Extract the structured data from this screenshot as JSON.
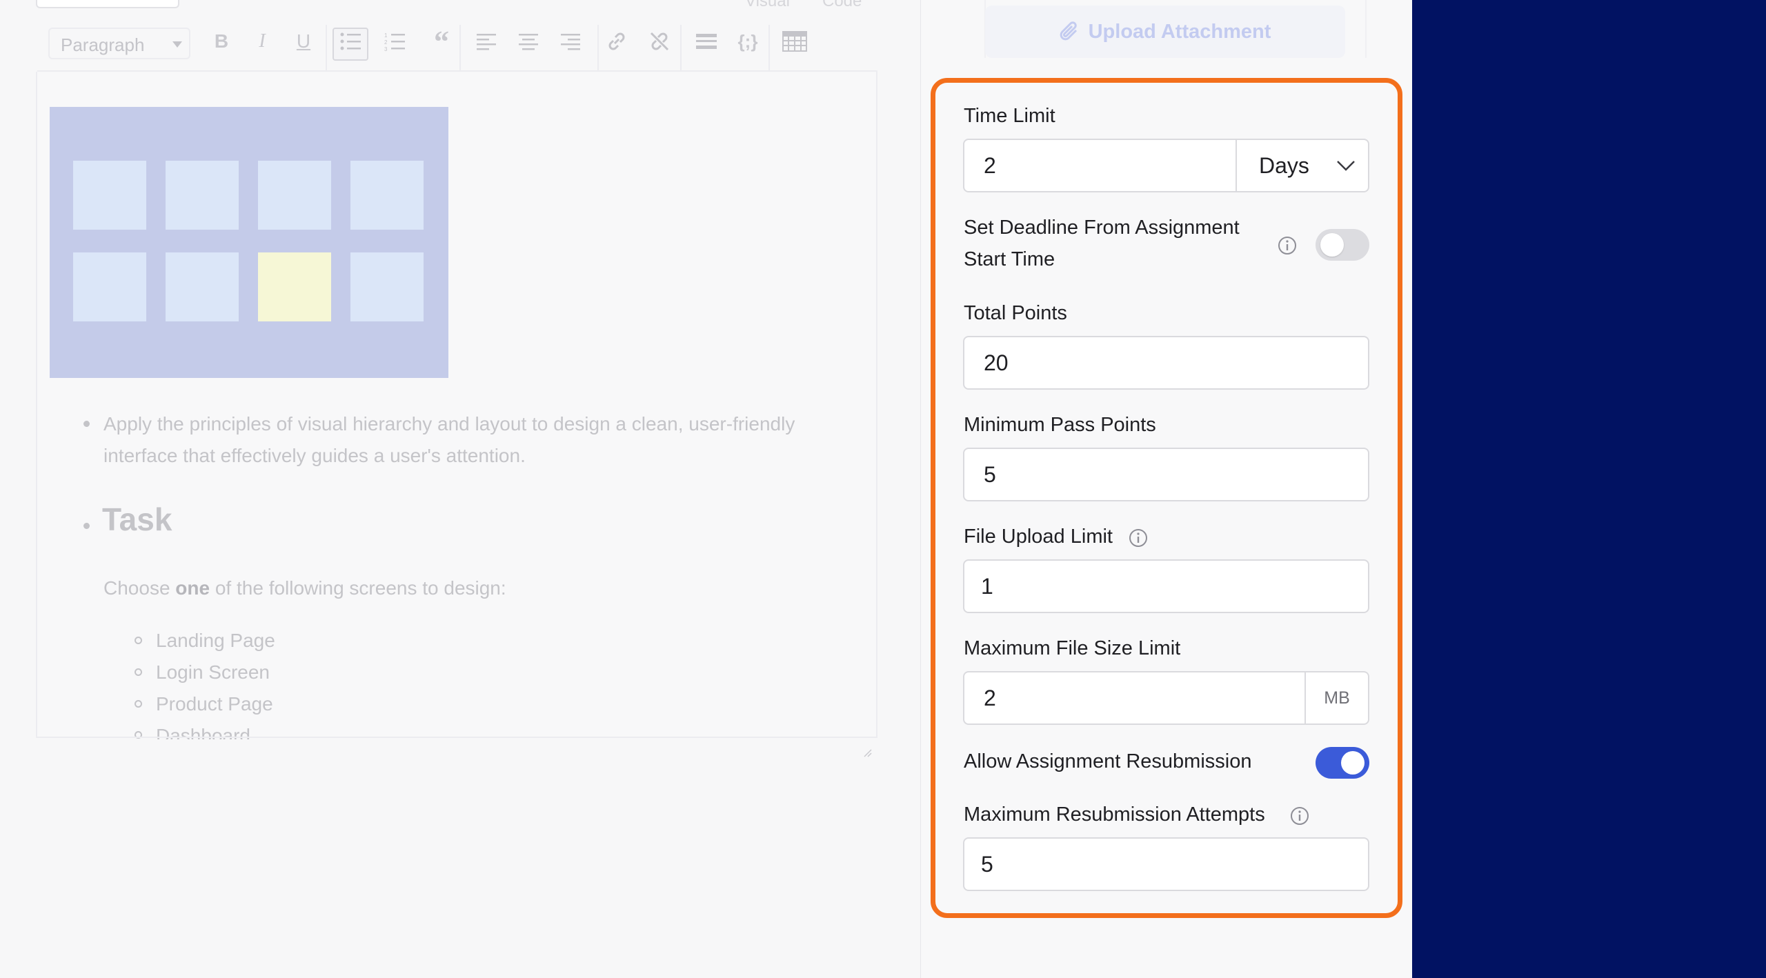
{
  "editor": {
    "tabs": [
      "Visual",
      "Code"
    ],
    "toolbar": {
      "format_select": "Paragraph",
      "buttons": [
        "bold-icon",
        "italic-icon",
        "underline-icon",
        "bullet-list-icon",
        "numbered-list-icon",
        "blockquote-icon",
        "align-left-icon",
        "align-center-icon",
        "align-right-icon",
        "link-icon",
        "unlink-icon",
        "horizontal-rule-icon",
        "code-icon",
        "table-icon"
      ]
    },
    "content": {
      "bullet_text_line1": "Apply the principles of visual hierarchy and layout to design a clean, user-friendly",
      "bullet_text_line2": "interface that effectively guides a user's attention.",
      "task_heading": "Task",
      "choose_prefix": "Choose ",
      "choose_bold": "one",
      "choose_suffix": " of the following screens to design:",
      "screens": [
        "Landing Page",
        "Login Screen",
        "Product Page",
        "Dashboard"
      ]
    }
  },
  "settings": {
    "upload_attachment_label": "Upload Attachment",
    "time_limit": {
      "label": "Time Limit",
      "value": "2",
      "unit": "Days"
    },
    "deadline_toggle": {
      "label_line1": "Set Deadline From Assignment",
      "label_line2": "Start Time",
      "on": false
    },
    "total_points": {
      "label": "Total Points",
      "value": "20"
    },
    "min_pass_points": {
      "label": "Minimum Pass Points",
      "value": "5"
    },
    "file_upload_limit": {
      "label": "File Upload Limit",
      "value": "1"
    },
    "max_file_size": {
      "label": "Maximum File Size Limit",
      "value": "2",
      "unit": "MB"
    },
    "resubmission_toggle": {
      "label": "Allow Assignment Resubmission",
      "on": true
    },
    "max_resubmission": {
      "label": "Maximum Resubmission Attempts",
      "value": "5"
    }
  },
  "colors": {
    "highlight_border": "#f36f1c",
    "toggle_on": "#3b5bd9",
    "right_panel": "#011262"
  }
}
